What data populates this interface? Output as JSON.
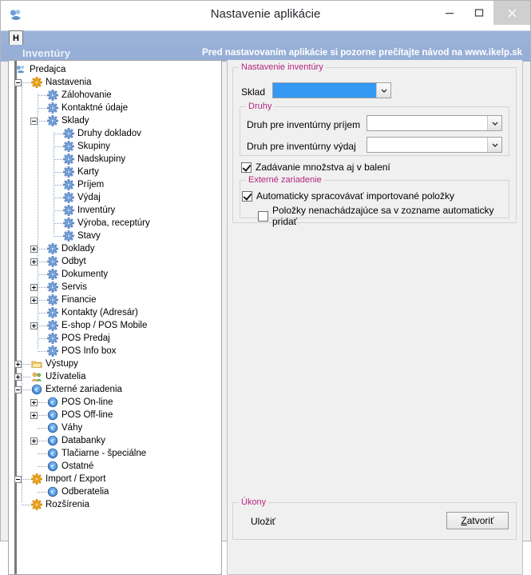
{
  "window": {
    "title": "Nastavenie aplikácie",
    "app_icon": "app-logo-icon",
    "minimize_label": "Minimalizovať",
    "maximize_label": "Maximalizovať",
    "close_label": "Zavrieť"
  },
  "menubar": {
    "items": [
      "H"
    ]
  },
  "banner": {
    "left": "Inventúry",
    "right": "Pred nastavovaním aplikácie si pozorne prečítajte návod na www.ikelp.sk",
    "bg_color": "#97afd7"
  },
  "tree": {
    "nodes": [
      {
        "label": "Predajca",
        "depth": 0,
        "icon": "app-logo-icon",
        "expander": "none"
      },
      {
        "label": "Nastavenia",
        "depth": 1,
        "icon": "gear-orange-icon",
        "expander": "minus"
      },
      {
        "label": "Zálohovanie",
        "depth": 2,
        "icon": "gear-blue-icon",
        "expander": "none"
      },
      {
        "label": "Kontaktné údaje",
        "depth": 2,
        "icon": "gear-blue-icon",
        "expander": "none"
      },
      {
        "label": "Sklady",
        "depth": 2,
        "icon": "gear-blue-icon",
        "expander": "minus"
      },
      {
        "label": "Druhy dokladov",
        "depth": 3,
        "icon": "gear-blue-icon",
        "expander": "none"
      },
      {
        "label": "Skupiny",
        "depth": 3,
        "icon": "gear-blue-icon",
        "expander": "none"
      },
      {
        "label": "Nadskupiny",
        "depth": 3,
        "icon": "gear-blue-icon",
        "expander": "none"
      },
      {
        "label": "Karty",
        "depth": 3,
        "icon": "gear-blue-icon",
        "expander": "none"
      },
      {
        "label": "Príjem",
        "depth": 3,
        "icon": "gear-blue-icon",
        "expander": "none"
      },
      {
        "label": "Výdaj",
        "depth": 3,
        "icon": "gear-blue-icon",
        "expander": "none"
      },
      {
        "label": "Inventúry",
        "depth": 3,
        "icon": "gear-blue-icon",
        "expander": "none"
      },
      {
        "label": "Výroba, receptúry",
        "depth": 3,
        "icon": "gear-blue-icon",
        "expander": "none"
      },
      {
        "label": "Stavy",
        "depth": 3,
        "icon": "gear-blue-icon",
        "expander": "none"
      },
      {
        "label": "Doklady",
        "depth": 2,
        "icon": "gear-blue-icon",
        "expander": "plus"
      },
      {
        "label": "Odbyt",
        "depth": 2,
        "icon": "gear-blue-icon",
        "expander": "plus"
      },
      {
        "label": "Dokumenty",
        "depth": 2,
        "icon": "gear-blue-icon",
        "expander": "none"
      },
      {
        "label": "Servis",
        "depth": 2,
        "icon": "gear-blue-icon",
        "expander": "plus"
      },
      {
        "label": "Financie",
        "depth": 2,
        "icon": "gear-blue-icon",
        "expander": "plus"
      },
      {
        "label": "Kontakty (Adresár)",
        "depth": 2,
        "icon": "gear-blue-icon",
        "expander": "none"
      },
      {
        "label": "E-shop / POS Mobile",
        "depth": 2,
        "icon": "gear-blue-icon",
        "expander": "plus"
      },
      {
        "label": "POS Predaj",
        "depth": 2,
        "icon": "gear-blue-icon",
        "expander": "none"
      },
      {
        "label": "POS Info box",
        "depth": 2,
        "icon": "gear-blue-icon",
        "expander": "none"
      },
      {
        "label": "Výstupy",
        "depth": 1,
        "icon": "folder-icon",
        "expander": "plus"
      },
      {
        "label": "Užívatelia",
        "depth": 1,
        "icon": "users-icon",
        "expander": "plus"
      },
      {
        "label": "Externé zariadenia",
        "depth": 1,
        "icon": "euro-circle-icon",
        "expander": "minus"
      },
      {
        "label": "POS On-line",
        "depth": 2,
        "icon": "euro-circle-icon",
        "expander": "plus"
      },
      {
        "label": "POS Off-line",
        "depth": 2,
        "icon": "euro-circle-icon",
        "expander": "plus"
      },
      {
        "label": "Váhy",
        "depth": 2,
        "icon": "euro-circle-icon",
        "expander": "none"
      },
      {
        "label": "Databanky",
        "depth": 2,
        "icon": "euro-circle-icon",
        "expander": "plus"
      },
      {
        "label": "Tlačiarne - špeciálne",
        "depth": 2,
        "icon": "euro-circle-icon",
        "expander": "none"
      },
      {
        "label": "Ostatné",
        "depth": 2,
        "icon": "euro-circle-icon",
        "expander": "none"
      },
      {
        "label": "Import / Export",
        "depth": 1,
        "icon": "gear-orange-icon",
        "expander": "minus"
      },
      {
        "label": "Odberatelia",
        "depth": 2,
        "icon": "euro-circle-icon",
        "expander": "none"
      },
      {
        "label": "Rozšírenia",
        "depth": 1,
        "icon": "gear-orange-icon",
        "expander": "none"
      }
    ]
  },
  "panel": {
    "group_main_label": "Nastavenie inventúry",
    "sklad_label": "Sklad",
    "sklad_value": "",
    "group_druhy_label": "Druhy",
    "druh_prijem_label": "Druh pre inventúrny príjem",
    "druh_prijem_value": "",
    "druh_vydaj_label": "Druh pre inventúrny výdaj",
    "druh_vydaj_value": "",
    "cb_mnozstvo_label": "Zadávanie množstva aj v balení",
    "cb_mnozstvo_checked": true,
    "group_externe_label": "Externé zariadenie",
    "cb_auto_label": "Automaticky spracovávať importované položky",
    "cb_auto_checked": true,
    "cb_pridat_label": "Položky nenachádzajúce sa v zozname automaticky pridať",
    "cb_pridat_checked": false,
    "group_ukony_label": "Úkony",
    "ulozit_label": "Uložiť",
    "zatvorit_accel": "Z",
    "zatvorit_rest": "atvoriť",
    "accent_label_color": "#b4267f"
  }
}
